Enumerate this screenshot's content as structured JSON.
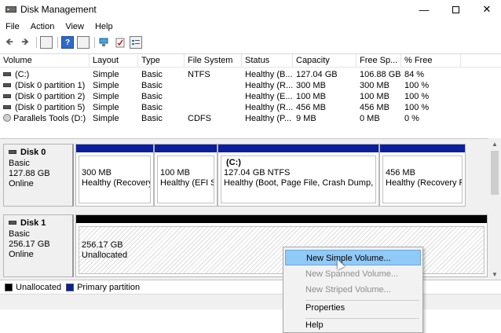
{
  "window": {
    "title": "Disk Management",
    "min": "—",
    "close": "✕"
  },
  "menu": [
    "File",
    "Action",
    "View",
    "Help"
  ],
  "toolbar": {
    "back": "🡸",
    "forward": "🡺",
    "help": "?"
  },
  "volume_list": {
    "columns": [
      "Volume",
      "Layout",
      "Type",
      "File System",
      "Status",
      "Capacity",
      "Free Sp...",
      "% Free"
    ],
    "rows": [
      [
        "(C:)",
        "Simple",
        "Basic",
        "NTFS",
        "Healthy (B...",
        "127.04 GB",
        "106.88 GB",
        "84 %"
      ],
      [
        "(Disk 0 partition 1)",
        "Simple",
        "Basic",
        "",
        "Healthy (R...",
        "300 MB",
        "300 MB",
        "100 %"
      ],
      [
        "(Disk 0 partition 2)",
        "Simple",
        "Basic",
        "",
        "Healthy (E...",
        "100 MB",
        "100 MB",
        "100 %"
      ],
      [
        "(Disk 0 partition 5)",
        "Simple",
        "Basic",
        "",
        "Healthy (R...",
        "456 MB",
        "456 MB",
        "100 %"
      ],
      [
        "Parallels Tools (D:)",
        "Simple",
        "Basic",
        "CDFS",
        "Healthy (P...",
        "9 MB",
        "0 MB",
        "0 %"
      ]
    ]
  },
  "disks": [
    {
      "name": "Disk 0",
      "type": "Basic",
      "size": "127.88 GB",
      "state": "Online",
      "partitions": [
        {
          "title": "",
          "size": "300 MB",
          "status": "Healthy (Recovery I"
        },
        {
          "title": "",
          "size": "100 MB",
          "status": "Healthy (EFI Sy"
        },
        {
          "title": "(C:)",
          "size": "127.04 GB NTFS",
          "status": "Healthy (Boot, Page File, Crash Dump, Prir"
        },
        {
          "title": "",
          "size": "456 MB",
          "status": "Healthy (Recovery Pa"
        }
      ]
    },
    {
      "name": "Disk 1",
      "type": "Basic",
      "size": "256.17 GB",
      "state": "Online",
      "unallocated": {
        "size": "256.17 GB",
        "label": "Unallocated"
      }
    }
  ],
  "legend": [
    {
      "label": "Unallocated",
      "color": "#000000"
    },
    {
      "label": "Primary partition",
      "color": "#0a1e9e"
    }
  ],
  "context_menu": {
    "items": [
      {
        "label": "New Simple Volume...",
        "state": "highlighted"
      },
      {
        "label": "New Spanned Volume...",
        "state": "disabled"
      },
      {
        "label": "New Striped Volume...",
        "state": "disabled"
      },
      {
        "label": "Properties",
        "state": "enabled"
      },
      {
        "label": "Help",
        "state": "enabled"
      }
    ]
  },
  "colors": {
    "primary_partition": "#0a1e9e",
    "highlight": "#91c9f7"
  }
}
